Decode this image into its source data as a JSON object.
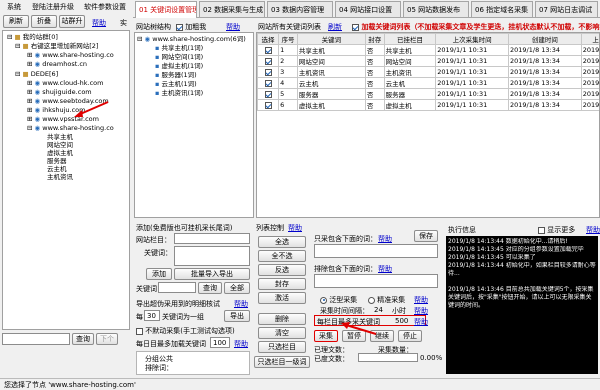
{
  "menu": {
    "items": [
      "系统",
      "登陆注册升级",
      "软件参数设置"
    ]
  },
  "left_toolbar": {
    "refresh": "刷新",
    "collapse": "折叠",
    "sites": "站群升",
    "help": "帮助",
    "cut_label": "实"
  },
  "tree": {
    "root": "我的站群[0]",
    "group1": "右键这里增加新网站[2]",
    "sites1": [
      "www.share-hosting.co",
      "dreamhost.cn"
    ],
    "group2": "DEDE[6]",
    "sites2": [
      "www.cloud-hk.com",
      "shujiguide.com",
      "www.seebtoday.com",
      "ihkshuju.com",
      "www.vpsstar.com",
      "www.share-hosting.co"
    ],
    "columns": [
      "共享主机",
      "网站空间",
      "虚拟主机",
      "服务器",
      "云主机",
      "主机资讯"
    ]
  },
  "left_bottom": {
    "query": "查询",
    "next": "下个"
  },
  "status": {
    "text": "您选择了节点 'www.share-hosting.com'"
  },
  "tabs": [
    "01 关键词设置管理",
    "02 数据采集与生成",
    "03 数据内容管理",
    "04 网站接口设置",
    "05 网站数据发布",
    "06 指定域名采集",
    "07 网站日志调试"
  ],
  "kw_tree_header": {
    "title": "网站树结构",
    "bold": "加粗我",
    "help": "帮助"
  },
  "kw_tree": {
    "site": "www.share-hosting.com(6词)",
    "items": [
      "共享主机(1词)",
      "网站空间(1词)",
      "虚拟主机(1词)",
      "服务器(1词)",
      "云主机(1词)",
      "主机资讯(1词)"
    ]
  },
  "kw_table_header": {
    "title": "网站所有关键词列表",
    "refresh": "刷新",
    "note": "加载关键词列表（不加载采集文章及学生更迭，挂机状态默认不加载，不影响实际使用）"
  },
  "kw_table": {
    "headers": [
      "选择",
      "序号",
      "关键词",
      "封存",
      "已挂栏目",
      "上次采集时间",
      "创建时间",
      "上次"
    ],
    "rows": [
      [
        "1",
        "共享主机",
        "否",
        "共享主机",
        "2019/1/1 10:31",
        "2019/1/8 13:34",
        "2019"
      ],
      [
        "2",
        "网站空间",
        "否",
        "网站空间",
        "2019/1/1 10:31",
        "2019/1/8 13:34",
        "2019"
      ],
      [
        "3",
        "主机资讯",
        "否",
        "主机资讯",
        "2019/1/1 10:31",
        "2019/1/8 13:34",
        "2019"
      ],
      [
        "4",
        "云主机",
        "否",
        "云主机",
        "2019/1/1 10:31",
        "2019/1/8 13:34",
        "2019"
      ],
      [
        "5",
        "服务器",
        "否",
        "服务器",
        "2019/1/1 10:31",
        "2019/1/8 13:34",
        "2019"
      ],
      [
        "6",
        "虚拟主机",
        "否",
        "虚拟主机",
        "2019/1/1 10:31",
        "2019/1/8 13:34",
        "2019"
      ]
    ]
  },
  "add_panel": {
    "title": "添加(免费版也可挂机采长尾词)",
    "column_label": "网站栏目：",
    "keyword_label": "关键词：",
    "add": "添加",
    "batch_import": "批量导入导出",
    "keyword_field_label": "关键词",
    "query": "查询",
    "all": "全部",
    "export_label": "导出超伪采用到的明细核试",
    "help": "帮助",
    "per_label": "每",
    "per_value": "30",
    "per_unit": "关键词为一组",
    "export": "导出",
    "no_repeat": "不默动采集(手工测试勾选项)",
    "daily_label": "每日目最多加载关键词",
    "daily_value": "100",
    "daily_help": "帮助",
    "group_label": "分组公共",
    "col_label": "排除词："
  },
  "list_control": {
    "title": "列表控制",
    "help": "帮助",
    "buttons": [
      "全选",
      "全不选",
      "反选",
      "封存",
      "激活",
      "删除",
      "清空",
      "只选栏目",
      "只选栏目一级词"
    ]
  },
  "collect_panel": {
    "include_label": "只采包含下面的词：",
    "help": "帮助",
    "save": "保存",
    "exclude_label": "排除包含下面的词：",
    "mode_pan": "泛型采集",
    "mode_exact": "精准采集",
    "interval_label": "采集时间间隔：",
    "interval_value": "24",
    "interval_unit": "小时",
    "daily_label": "每栏目最多采关键词",
    "daily_value": "500",
    "collect": "采集",
    "pause": "暂停",
    "continue": "继续",
    "stop": "停止",
    "progress_text": "0%",
    "progress": 0,
    "processed_label": "已理文数：",
    "remaining_label": "已度文数：",
    "collect_count": "采集数量：",
    "collect_count_value": "0.00%"
  },
  "info_panel": {
    "title": "执行信息",
    "show_more": "显示更多",
    "help": "帮助",
    "logs": [
      "2019/1/8 14:13:44  数据初始化中...请稍后!",
      "2019/1/8 14:13:45  对应的分组参数设置加载完毕",
      "2019/1/8 14:13:45  可以采集了",
      "2019/1/8 14:13:44  初始化中，如果栏目较多请耐心等待...",
      "",
      "2019/1/8 14:13:46  目前总共加载关键词5个，按采集关键词后，按\"采集\"按钮开始，请以上可以无限采集关键词的时间。"
    ]
  },
  "colors": {
    "red": "#d00000",
    "link": "#0000cc",
    "log_bg": "#000000"
  }
}
